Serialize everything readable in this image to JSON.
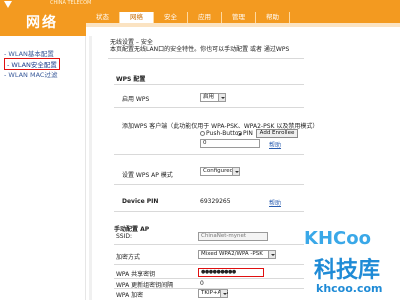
{
  "header": {
    "logo_sub": "CHINA TELECOM",
    "section_title": "网络",
    "tabs": [
      {
        "label": "状态",
        "active": false
      },
      {
        "label": "网络",
        "active": true
      },
      {
        "label": "安全",
        "active": false
      },
      {
        "label": "应用",
        "active": false
      },
      {
        "label": "管理",
        "active": false
      },
      {
        "label": "帮助",
        "active": false
      }
    ]
  },
  "sidebar": {
    "items": [
      {
        "label": "- WLAN基本配置",
        "selected": false
      },
      {
        "label": "- WLAN安全配置",
        "selected": true
      },
      {
        "label": "- WLAN MAC过滤",
        "selected": false
      }
    ]
  },
  "content": {
    "intro_line1": "无线设置 – 安全",
    "intro_line2": "本页配置无线LAN口的安全特性。你也可以手动配置 或者 通过WPS",
    "wps_heading": "WPS 配置",
    "enable_wps_label": "启用 WPS",
    "enable_wps_value": "启用",
    "add_client_label": "添加WPS 客户端（此功能仅用于 WPA-PSK、WPA2-PSK 以及禁用模式）",
    "push_button_label": "Push-Button",
    "pin_label": "PIN",
    "add_enrollee_label": "Add Enrollee",
    "pin_input_value": "0",
    "help_link": "帮助",
    "ap_mode_label": "设置 WPS AP 模式",
    "ap_mode_value": "Configured",
    "device_pin_label": "Device PIN",
    "device_pin_value": "69329265",
    "manual_heading": "手动配置 AP",
    "ssid_label": "SSID:",
    "ssid_value": "ChinaNet-mynet",
    "encryption_label": "加密方式",
    "encryption_value": "Mixed WPA2/WPA -PSK",
    "shared_key_label": "WPA 共享密钥",
    "shared_key_value": "●●●●●●●●●",
    "rekey_label": "WPA 更新组密钥间隔",
    "rekey_value": "0",
    "wpa_encryption_label": "WPA 加密",
    "wpa_encryption_value": "TKIP+AES"
  },
  "watermark": {
    "logo": "KHCoo",
    "name": "科技库",
    "url": "khcoo.com"
  },
  "colors": {
    "header_orange": "#f39a20",
    "highlight_red": "#e01010",
    "watermark_blue": "#1f8bd6"
  }
}
